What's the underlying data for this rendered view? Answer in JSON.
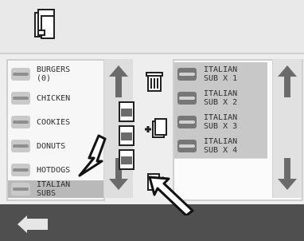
{
  "left_list": {
    "items": [
      {
        "label": "BURGERS\n(0)",
        "icon": "burger-icon"
      },
      {
        "label": "CHICKEN",
        "icon": "chicken-icon"
      },
      {
        "label": "COOKIES",
        "icon": "cookie-icon"
      },
      {
        "label": "DONUTS",
        "icon": "donut-icon"
      },
      {
        "label": "HOTDOGS",
        "icon": "hotdog-icon"
      },
      {
        "label": "ITALIAN\nSUBS",
        "icon": "sub-icon",
        "selected": true
      }
    ]
  },
  "right_list": {
    "items": [
      {
        "label": "ITALIAN\nSUB X 1"
      },
      {
        "label": "ITALIAN\nSUB X 2"
      },
      {
        "label": "ITALIAN\nSUB X 3"
      },
      {
        "label": "ITALIAN\nSUB X 4"
      }
    ]
  },
  "icons": {
    "order": "order-clipboard-icon",
    "clear_order": "trash-can-icon",
    "add_item": "add-to-order-icon",
    "edit_item": "edit-order-icon",
    "up_arrow": "arrow-up-icon",
    "down_arrow": "arrow-down-icon",
    "back": "back-arrow-icon"
  }
}
